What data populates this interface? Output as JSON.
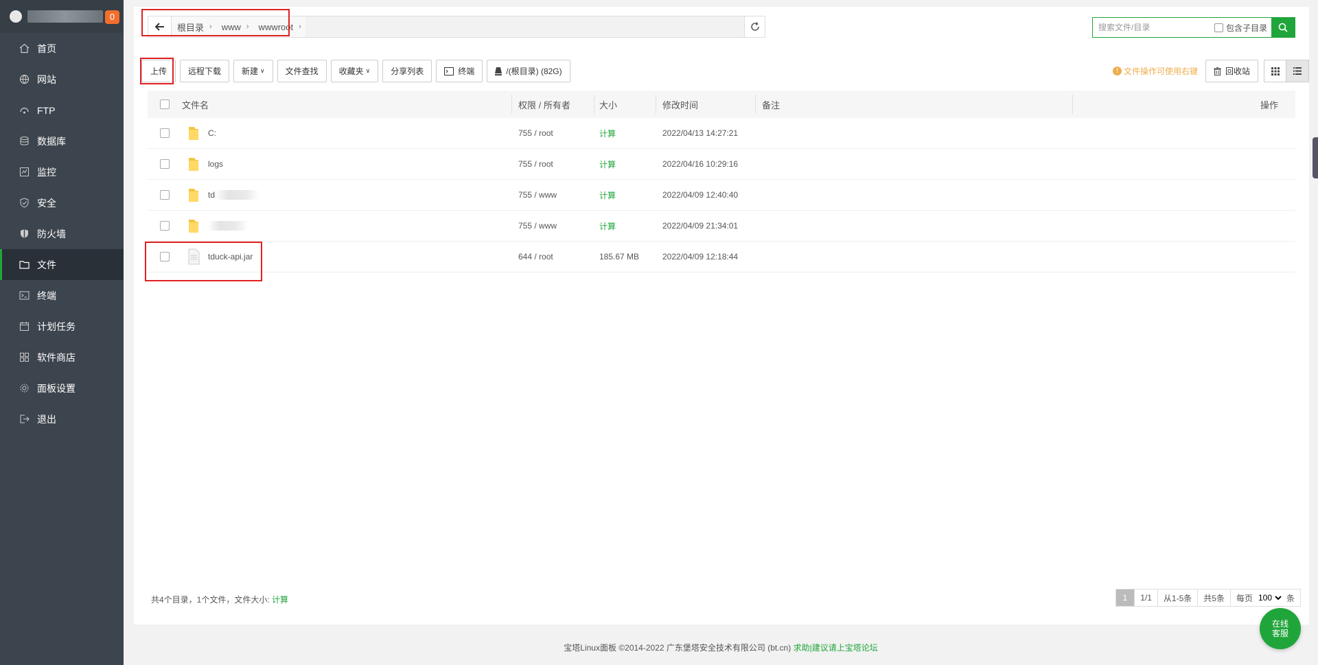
{
  "sidebar": {
    "server_name": "",
    "notification_count": "0",
    "items": [
      {
        "label": "首页",
        "icon": "home-icon"
      },
      {
        "label": "网站",
        "icon": "globe-icon"
      },
      {
        "label": "FTP",
        "icon": "ftp-icon"
      },
      {
        "label": "数据库",
        "icon": "database-icon"
      },
      {
        "label": "监控",
        "icon": "monitor-icon"
      },
      {
        "label": "安全",
        "icon": "shield-icon"
      },
      {
        "label": "防火墙",
        "icon": "firewall-icon"
      },
      {
        "label": "文件",
        "icon": "folder-icon",
        "active": true
      },
      {
        "label": "终端",
        "icon": "terminal-icon"
      },
      {
        "label": "计划任务",
        "icon": "calendar-icon"
      },
      {
        "label": "软件商店",
        "icon": "apps-icon"
      },
      {
        "label": "面板设置",
        "icon": "gear-icon"
      },
      {
        "label": "退出",
        "icon": "logout-icon"
      }
    ]
  },
  "path": {
    "crumbs": [
      "根目录",
      "www",
      "wwwroot"
    ]
  },
  "search": {
    "placeholder": "搜索文件/目录",
    "include_sub_label": "包含子目录"
  },
  "toolbar": {
    "upload": "上传",
    "remote_download": "远程下载",
    "new": "新建",
    "file_search": "文件查找",
    "favorites": "收藏夹",
    "share_list": "分享列表",
    "terminal": "终端",
    "disk": "/(根目录) (82G)",
    "tip": "文件操作可使用右键",
    "recycle": "回收站"
  },
  "table": {
    "headers": {
      "name": "文件名",
      "perm": "权限 / 所有者",
      "size": "大小",
      "mtime": "修改时间",
      "remark": "备注",
      "ops": "操作"
    },
    "rows": [
      {
        "name": "C:",
        "type": "folder",
        "perm": "755 / root",
        "size": "计算",
        "mtime": "2022/04/13 14:27:21"
      },
      {
        "name": "logs",
        "type": "folder",
        "perm": "755 / root",
        "size": "计算",
        "mtime": "2022/04/16 10:29:16"
      },
      {
        "name": "td",
        "type": "folder",
        "perm": "755 / www",
        "size": "计算",
        "mtime": "2022/04/09 12:40:40"
      },
      {
        "name": "",
        "type": "folder",
        "perm": "755 / www",
        "size": "计算",
        "mtime": "2022/04/09 21:34:01"
      },
      {
        "name": "tduck-api.jar",
        "type": "file",
        "perm": "644 / root",
        "size": "185.67 MB",
        "mtime": "2022/04/09 12:18:44"
      }
    ]
  },
  "summary": {
    "text": "共4个目录，1个文件，文件大小:",
    "calc": "计算"
  },
  "pager": {
    "current": "1",
    "pages": "1/1",
    "range": "从1-5条",
    "total": "共5条",
    "per_page_label": "每页",
    "per_page_value": "100",
    "unit": "条"
  },
  "footer": {
    "copyright": "宝塔Linux面板 ©2014-2022 广东堡塔安全技术有限公司 (bt.cn)",
    "help": "求助|建议请上宝塔论坛"
  },
  "online_service": {
    "line1": "在线",
    "line2": "客服"
  },
  "colors": {
    "accent": "#20a53a",
    "sidebar_bg": "#3c444d",
    "highlight": "#e02020",
    "warning": "#f0ad4e"
  }
}
